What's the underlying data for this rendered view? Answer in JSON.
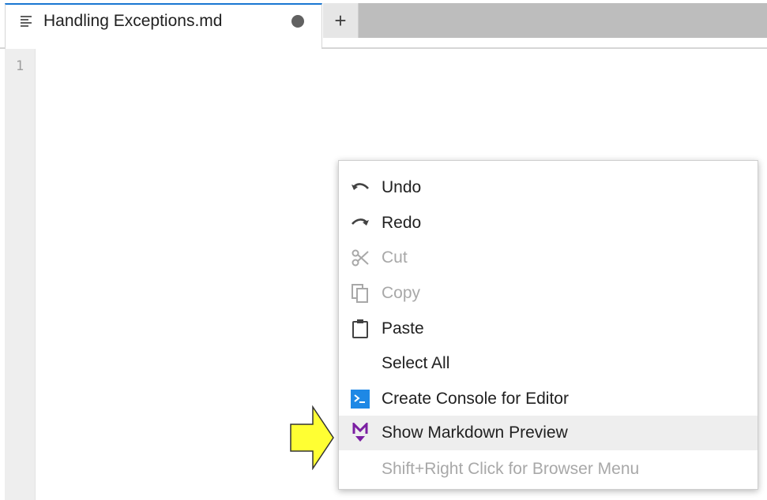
{
  "tabs": [
    {
      "label": "Handling Exceptions.md",
      "icon": "markdown-file-icon",
      "modified": true
    }
  ],
  "add_tab_label": "+",
  "editor": {
    "line_numbers": [
      "1"
    ]
  },
  "context_menu": {
    "items": [
      {
        "label": "Undo",
        "icon": "undo-icon",
        "enabled": true
      },
      {
        "label": "Redo",
        "icon": "redo-icon",
        "enabled": true
      },
      {
        "label": "Cut",
        "icon": "cut-icon",
        "enabled": false
      },
      {
        "label": "Copy",
        "icon": "copy-icon",
        "enabled": false
      },
      {
        "label": "Paste",
        "icon": "paste-icon",
        "enabled": true
      },
      {
        "label": "Select All",
        "icon": "",
        "enabled": true
      },
      {
        "label": "Create Console for Editor",
        "icon": "console-icon",
        "enabled": true
      },
      {
        "label": "Show Markdown Preview",
        "icon": "markdown-preview-icon",
        "enabled": true,
        "highlighted": true
      },
      {
        "label": "Shift+Right Click for Browser Menu",
        "icon": "",
        "enabled": false
      }
    ]
  },
  "colors": {
    "tab_accent": "#1976d2",
    "console_icon": "#1e88e5",
    "markdown_icon": "#7b1fa2",
    "pointer_arrow": "#ffff33"
  }
}
